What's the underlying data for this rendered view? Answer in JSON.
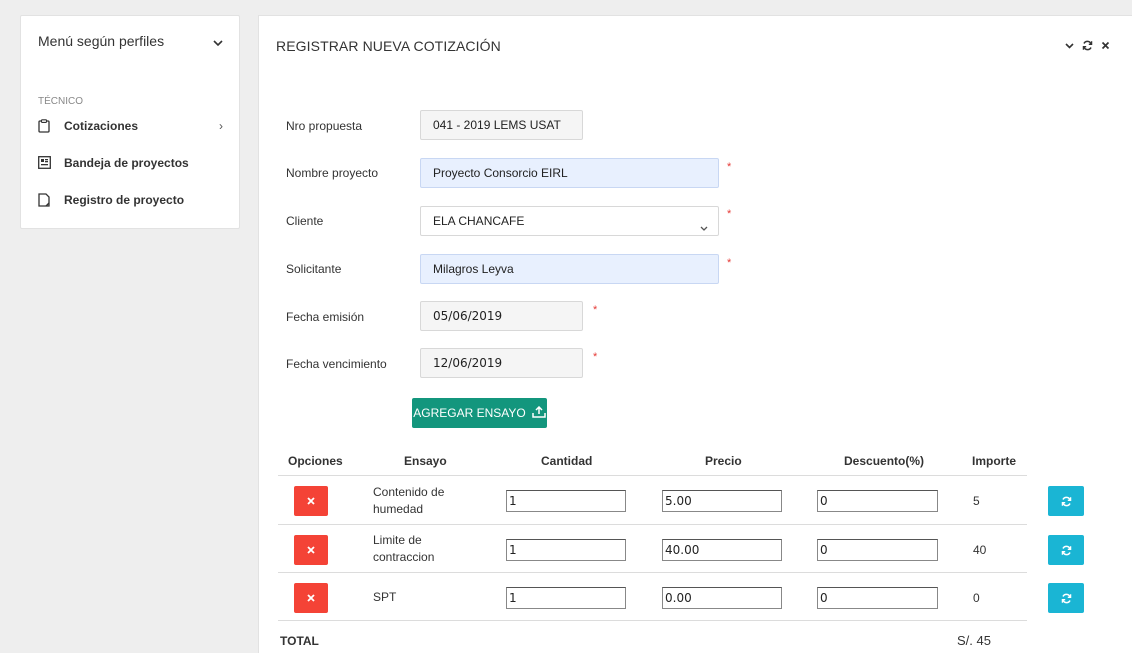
{
  "sidebar": {
    "header": "Menú según perfiles",
    "section": "TÉCNICO",
    "items": [
      {
        "label": "Cotizaciones",
        "icon": "clipboard-icon"
      },
      {
        "label": "Bandeja de proyectos",
        "icon": "tray-icon"
      },
      {
        "label": "Registro de proyecto",
        "icon": "document-icon"
      }
    ]
  },
  "main": {
    "title": "REGISTRAR NUEVA COTIZACIÓN",
    "form": {
      "nro_label": "Nro propuesta",
      "nro_value": "041 - 2019 LEMS USAT",
      "nombre_label": "Nombre proyecto",
      "nombre_value": "Proyecto Consorcio EIRL",
      "cliente_label": "Cliente",
      "cliente_value": "ELA CHANCAFE",
      "solicitante_label": "Solicitante",
      "solicitante_value": "Milagros Leyva",
      "emision_label": "Fecha emisión",
      "emision_value": "05/06/2019",
      "vencimiento_label": "Fecha vencimiento",
      "vencimiento_value": "12/06/2019",
      "required_mark": "*"
    },
    "add_button": "AGREGAR ENSAYO",
    "table": {
      "headers": [
        "Opciones",
        "Ensayo",
        "Cantidad",
        "Precio",
        "Descuento(%)",
        "Importe"
      ],
      "rows": [
        {
          "ensayo_line1": "Contenido de",
          "ensayo_line2": "humedad",
          "cantidad": "1",
          "precio": "5.00",
          "descuento": "0",
          "importe": "5"
        },
        {
          "ensayo_line1": "Limite de",
          "ensayo_line2": "contraccion",
          "cantidad": "1",
          "precio": "40.00",
          "descuento": "0",
          "importe": "40"
        },
        {
          "ensayo_line1": "SPT",
          "ensayo_line2": "",
          "cantidad": "1",
          "precio": "0.00",
          "descuento": "0",
          "importe": "0"
        }
      ],
      "total_label": "TOTAL",
      "total_value": "S/. 45"
    }
  },
  "colors": {
    "accent_green": "#13967d",
    "delete_red": "#f44336",
    "refresh_cyan": "#1ab5d4",
    "required_red": "#e53935"
  }
}
